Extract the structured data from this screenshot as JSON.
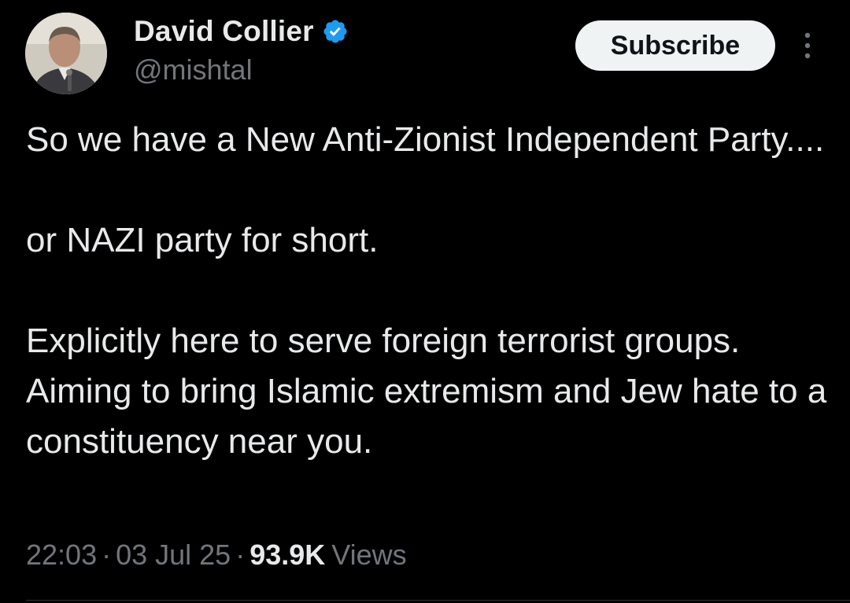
{
  "author": {
    "display_name": "David Collier",
    "handle": "@mishtal",
    "verified": true,
    "verified_color": "#1d9bf0",
    "avatar_icon": "profile-photo"
  },
  "actions": {
    "subscribe_label": "Subscribe",
    "more_icon": "more-vertical-icon"
  },
  "tweet": {
    "paragraphs": [
      "So we have a New Anti-Zionist Independent Party....",
      "or NAZI party for short.",
      "Explicitly here to serve foreign terrorist groups. Aiming to bring Islamic extremism and Jew hate to a constituency near you."
    ],
    "time": "22:03",
    "date": "03 Jul 25",
    "separator": "·",
    "views_count": "93.9K",
    "views_label": "Views"
  },
  "colors": {
    "background": "#000000",
    "primary_text": "#e7e9ea",
    "secondary_text": "#71767b",
    "button_bg": "#eff3f4",
    "button_text": "#0f1419"
  }
}
